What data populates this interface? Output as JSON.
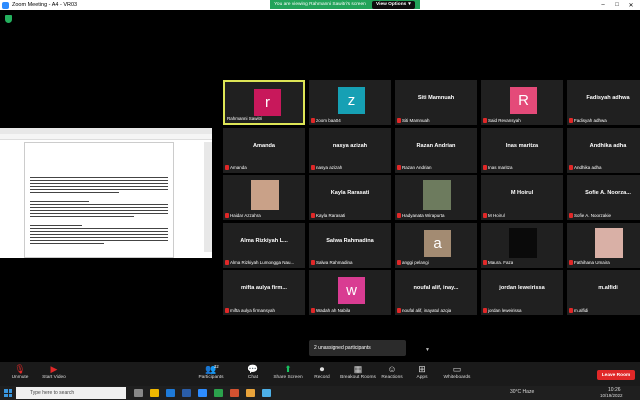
{
  "window": {
    "title": "Zoom Meeting - A4 - VR03",
    "minimize": "–",
    "maximize": "□",
    "close": "✕"
  },
  "banner": {
    "message": "You are viewing Rahmanni Sawitri's screen",
    "view_options": "View Options",
    "chevron": "▾"
  },
  "participants_grid": [
    {
      "name": "Rahmanni Sawitri",
      "type": "avatar",
      "letter": "r",
      "color": "#c8185b",
      "active": true,
      "muted": false
    },
    {
      "name": "zoom baa04",
      "type": "avatar",
      "letter": "z",
      "color": "#16a0b4",
      "active": false,
      "muted": true
    },
    {
      "name": "Siti Mamnuah",
      "type": "name",
      "active": false,
      "muted": true
    },
    {
      "name": "Said Revansyah",
      "type": "avatar",
      "letter": "R",
      "color": "#e44a79",
      "active": false,
      "muted": true
    },
    {
      "name": "Fadisyah adhwa",
      "type": "name",
      "active": false,
      "muted": true
    },
    {
      "name": "Amanda",
      "type": "name",
      "active": false,
      "muted": true
    },
    {
      "name": "nasya azizah",
      "type": "name",
      "active": false,
      "muted": true
    },
    {
      "name": "Razan Andrian",
      "type": "name",
      "active": false,
      "muted": true
    },
    {
      "name": "Inas maritza",
      "type": "name",
      "bigname": "Inas maritza",
      "active": false,
      "muted": true
    },
    {
      "name": "Andhika adha",
      "type": "name",
      "active": false,
      "muted": true
    },
    {
      "name": "Haidar Azzahra",
      "type": "photo",
      "photo_color": "#c9a188",
      "active": false,
      "muted": true
    },
    {
      "name": "Kayla Rarasati",
      "type": "name",
      "active": false,
      "muted": true
    },
    {
      "name": "Hadyanata Wirapurta",
      "type": "photo",
      "photo_color": "#6d7b5e",
      "active": false,
      "muted": true
    },
    {
      "name": "M Hoirul",
      "type": "name",
      "active": false,
      "muted": true
    },
    {
      "name": "Sofie A. Noorzakie",
      "type": "name",
      "bigname": "Sofie A. Noorza...",
      "active": false,
      "muted": true
    },
    {
      "name": "Alma Rizkiyah Lumongga Nau...",
      "type": "name",
      "bigname": "Alma Rizkiyah L...",
      "active": false,
      "muted": true
    },
    {
      "name": "Salwa Rahmadina",
      "type": "name",
      "active": false,
      "muted": true
    },
    {
      "name": "anggi pelangi",
      "type": "avatar",
      "letter": "a",
      "color": "#a38b72",
      "active": false,
      "muted": true
    },
    {
      "name": "Maura. Faza",
      "type": "photo",
      "photo_color": "#0a0a0a",
      "active": false,
      "muted": true
    },
    {
      "name": "Fathihana Umaira",
      "type": "photo",
      "photo_color": "#d9b0a6",
      "active": false,
      "muted": true
    },
    {
      "name": "mifta aulya firmansyah",
      "type": "name",
      "bigname": "mifta aulya firm...",
      "active": false,
      "muted": true
    },
    {
      "name": "Wadah ah Nabila",
      "type": "avatar",
      "letter": "w",
      "color": "#d93c92",
      "active": false,
      "muted": true
    },
    {
      "name": "noufal alif, inayatul azqia",
      "type": "name",
      "bigname": "noufal alif, inay...",
      "active": false,
      "muted": true
    },
    {
      "name": "jordan leweirissa",
      "type": "name",
      "active": false,
      "muted": true
    },
    {
      "name": "m.alfidi",
      "type": "name",
      "active": false,
      "muted": true
    }
  ],
  "unassigned": {
    "label": "2 unassigned participants"
  },
  "toolbar": {
    "unmute": "Unmute",
    "start_video": "Start Video",
    "participants": "Participants",
    "participants_count": "32",
    "chat": "Chat",
    "share_screen": "Share Screen",
    "record": "Record",
    "breakout_rooms": "Breakout Rooms",
    "reactions": "Reactions",
    "apps": "Apps",
    "whiteboards": "Whiteboards",
    "leave": "Leave Room"
  },
  "taskbar": {
    "search_placeholder": "Type here to search",
    "weather": "30°C Haze",
    "time": "10:26",
    "date": "10/19/2022"
  },
  "colors": {
    "accent_green": "#23a35a",
    "leave_red": "#e02828",
    "active_border": "#dde556"
  }
}
